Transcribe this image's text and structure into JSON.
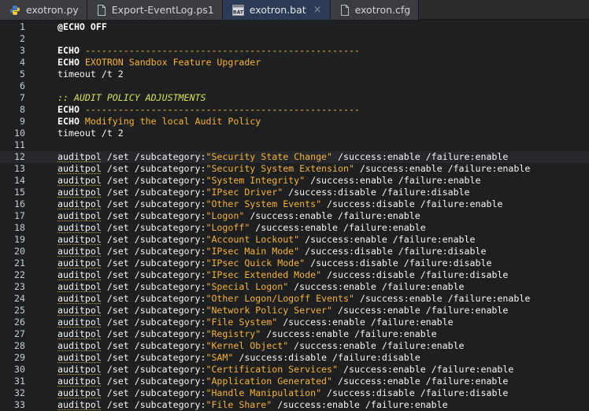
{
  "tabs": [
    {
      "label": "exotron.py",
      "icon": "python-file-icon",
      "active": false,
      "closable": false
    },
    {
      "label": "Export-EventLog.ps1",
      "icon": "document-file-icon",
      "active": false,
      "closable": false
    },
    {
      "label": "exotron.bat",
      "icon": "bat-file-icon",
      "icon_text": "BAT",
      "active": true,
      "closable": true,
      "close_glyph": "×"
    },
    {
      "label": "exotron.cfg",
      "icon": "document-file-icon",
      "active": false,
      "closable": false
    }
  ],
  "editor": {
    "current_line": 12,
    "lines": [
      {
        "n": "1",
        "parts": [
          [
            "cmd",
            "@ECHO OFF"
          ]
        ]
      },
      {
        "n": "2",
        "parts": []
      },
      {
        "n": "3",
        "parts": [
          [
            "cmd",
            "ECHO"
          ],
          [
            "dash",
            " --------------------------------------------------"
          ]
        ]
      },
      {
        "n": "4",
        "parts": [
          [
            "cmd",
            "ECHO"
          ],
          [
            "str",
            " EXOTRON Sandbox Feature Upgrader"
          ]
        ]
      },
      {
        "n": "5",
        "parts": [
          [
            "plain",
            "timeout /t 2"
          ]
        ]
      },
      {
        "n": "6",
        "parts": []
      },
      {
        "n": "7",
        "parts": [
          [
            "cmt",
            ":: AUDIT POLICY ADJUSTMENTS"
          ]
        ]
      },
      {
        "n": "8",
        "parts": [
          [
            "cmd",
            "ECHO"
          ],
          [
            "dash",
            " --------------------------------------------------"
          ]
        ]
      },
      {
        "n": "9",
        "parts": [
          [
            "cmd",
            "ECHO"
          ],
          [
            "str",
            " Modifying the local Audit Policy"
          ]
        ]
      },
      {
        "n": "10",
        "parts": [
          [
            "plain",
            "timeout /t 2"
          ]
        ]
      },
      {
        "n": "11",
        "parts": []
      },
      {
        "n": "12",
        "parts": [
          [
            "u",
            "auditpol"
          ],
          [
            "plain",
            " /set /subcategory:"
          ],
          [
            "str",
            "\"Security State Change\""
          ],
          [
            "plain",
            " /success:enable /failure:enable"
          ]
        ]
      },
      {
        "n": "13",
        "parts": [
          [
            "u",
            "auditpol"
          ],
          [
            "plain",
            " /set /subcategory:"
          ],
          [
            "str",
            "\"Security System Extension\""
          ],
          [
            "plain",
            " /success:enable /failure:enable"
          ]
        ]
      },
      {
        "n": "14",
        "parts": [
          [
            "u",
            "auditpol"
          ],
          [
            "plain",
            " /set /subcategory:"
          ],
          [
            "str",
            "\"System Integrity\""
          ],
          [
            "plain",
            " /success:enable /failure:enable"
          ]
        ]
      },
      {
        "n": "15",
        "parts": [
          [
            "u",
            "auditpol"
          ],
          [
            "plain",
            " /set /subcategory:"
          ],
          [
            "str",
            "\"IPsec Driver\""
          ],
          [
            "plain",
            " /success:disable /failure:disable"
          ]
        ]
      },
      {
        "n": "16",
        "parts": [
          [
            "u",
            "auditpol"
          ],
          [
            "plain",
            " /set /subcategory:"
          ],
          [
            "str",
            "\"Other System Events\""
          ],
          [
            "plain",
            " /success:disable /failure:enable"
          ]
        ]
      },
      {
        "n": "17",
        "parts": [
          [
            "u",
            "auditpol"
          ],
          [
            "plain",
            " /set /subcategory:"
          ],
          [
            "str",
            "\"Logon\""
          ],
          [
            "plain",
            " /success:enable /failure:enable"
          ]
        ]
      },
      {
        "n": "18",
        "parts": [
          [
            "u",
            "auditpol"
          ],
          [
            "plain",
            " /set /subcategory:"
          ],
          [
            "str",
            "\"Logoff\""
          ],
          [
            "plain",
            " /success:enable /failure:enable"
          ]
        ]
      },
      {
        "n": "19",
        "parts": [
          [
            "u",
            "auditpol"
          ],
          [
            "plain",
            " /set /subcategory:"
          ],
          [
            "str",
            "\"Account Lockout\""
          ],
          [
            "plain",
            " /success:enable /failure:enable"
          ]
        ]
      },
      {
        "n": "20",
        "parts": [
          [
            "u",
            "auditpol"
          ],
          [
            "plain",
            " /set /subcategory:"
          ],
          [
            "str",
            "\"IPsec Main Mode\""
          ],
          [
            "plain",
            " /success:disable /failure:disable"
          ]
        ]
      },
      {
        "n": "21",
        "parts": [
          [
            "u",
            "auditpol"
          ],
          [
            "plain",
            " /set /subcategory:"
          ],
          [
            "str",
            "\"IPsec Quick Mode\""
          ],
          [
            "plain",
            " /success:disable /failure:disable"
          ]
        ]
      },
      {
        "n": "22",
        "parts": [
          [
            "u",
            "auditpol"
          ],
          [
            "plain",
            " /set /subcategory:"
          ],
          [
            "str",
            "\"IPsec Extended Mode\""
          ],
          [
            "plain",
            " /success:disable /failure:disable"
          ]
        ]
      },
      {
        "n": "23",
        "parts": [
          [
            "u",
            "auditpol"
          ],
          [
            "plain",
            " /set /subcategory:"
          ],
          [
            "str",
            "\"Special Logon\""
          ],
          [
            "plain",
            " /success:enable /failure:enable"
          ]
        ]
      },
      {
        "n": "24",
        "parts": [
          [
            "u",
            "auditpol"
          ],
          [
            "plain",
            " /set /subcategory:"
          ],
          [
            "str",
            "\"Other Logon/Logoff Events\""
          ],
          [
            "plain",
            " /success:enable /failure:enable"
          ]
        ]
      },
      {
        "n": "25",
        "parts": [
          [
            "u",
            "auditpol"
          ],
          [
            "plain",
            " /set /subcategory:"
          ],
          [
            "str",
            "\"Network Policy Server\""
          ],
          [
            "plain",
            " /success:enable /failure:enable"
          ]
        ]
      },
      {
        "n": "26",
        "parts": [
          [
            "u",
            "auditpol"
          ],
          [
            "plain",
            " /set /subcategory:"
          ],
          [
            "str",
            "\"File System\""
          ],
          [
            "plain",
            " /success:enable /failure:enable"
          ]
        ]
      },
      {
        "n": "27",
        "parts": [
          [
            "u",
            "auditpol"
          ],
          [
            "plain",
            " /set /subcategory:"
          ],
          [
            "str",
            "\"Registry\""
          ],
          [
            "plain",
            " /success:enable /failure:enable"
          ]
        ]
      },
      {
        "n": "28",
        "parts": [
          [
            "u",
            "auditpol"
          ],
          [
            "plain",
            " /set /subcategory:"
          ],
          [
            "str",
            "\"Kernel Object\""
          ],
          [
            "plain",
            " /success:enable /failure:enable"
          ]
        ]
      },
      {
        "n": "29",
        "parts": [
          [
            "u",
            "auditpol"
          ],
          [
            "plain",
            " /set /subcategory:"
          ],
          [
            "str",
            "\"SAM\""
          ],
          [
            "plain",
            " /success:disable /failure:disable"
          ]
        ]
      },
      {
        "n": "30",
        "parts": [
          [
            "u",
            "auditpol"
          ],
          [
            "plain",
            " /set /subcategory:"
          ],
          [
            "str",
            "\"Certification Services\""
          ],
          [
            "plain",
            " /success:enable /failure:enable"
          ]
        ]
      },
      {
        "n": "31",
        "parts": [
          [
            "u",
            "auditpol"
          ],
          [
            "plain",
            " /set /subcategory:"
          ],
          [
            "str",
            "\"Application Generated\""
          ],
          [
            "plain",
            " /success:enable /failure:enable"
          ]
        ]
      },
      {
        "n": "32",
        "parts": [
          [
            "u",
            "auditpol"
          ],
          [
            "plain",
            " /set /subcategory:"
          ],
          [
            "str",
            "\"Handle Manipulation\""
          ],
          [
            "plain",
            " /success:disable /failure:disable"
          ]
        ]
      },
      {
        "n": "33",
        "parts": [
          [
            "u",
            "auditpol"
          ],
          [
            "plain",
            " /set /subcategory:"
          ],
          [
            "str",
            "\"File Share\""
          ],
          [
            "plain",
            " /success:enable /failure:enable"
          ]
        ]
      }
    ]
  },
  "colors": {
    "background": "#1e1f20",
    "active_tab": "#2c3b55",
    "string": "#f5b236",
    "comment": "#d4e157",
    "keyword": "#ffffff"
  }
}
